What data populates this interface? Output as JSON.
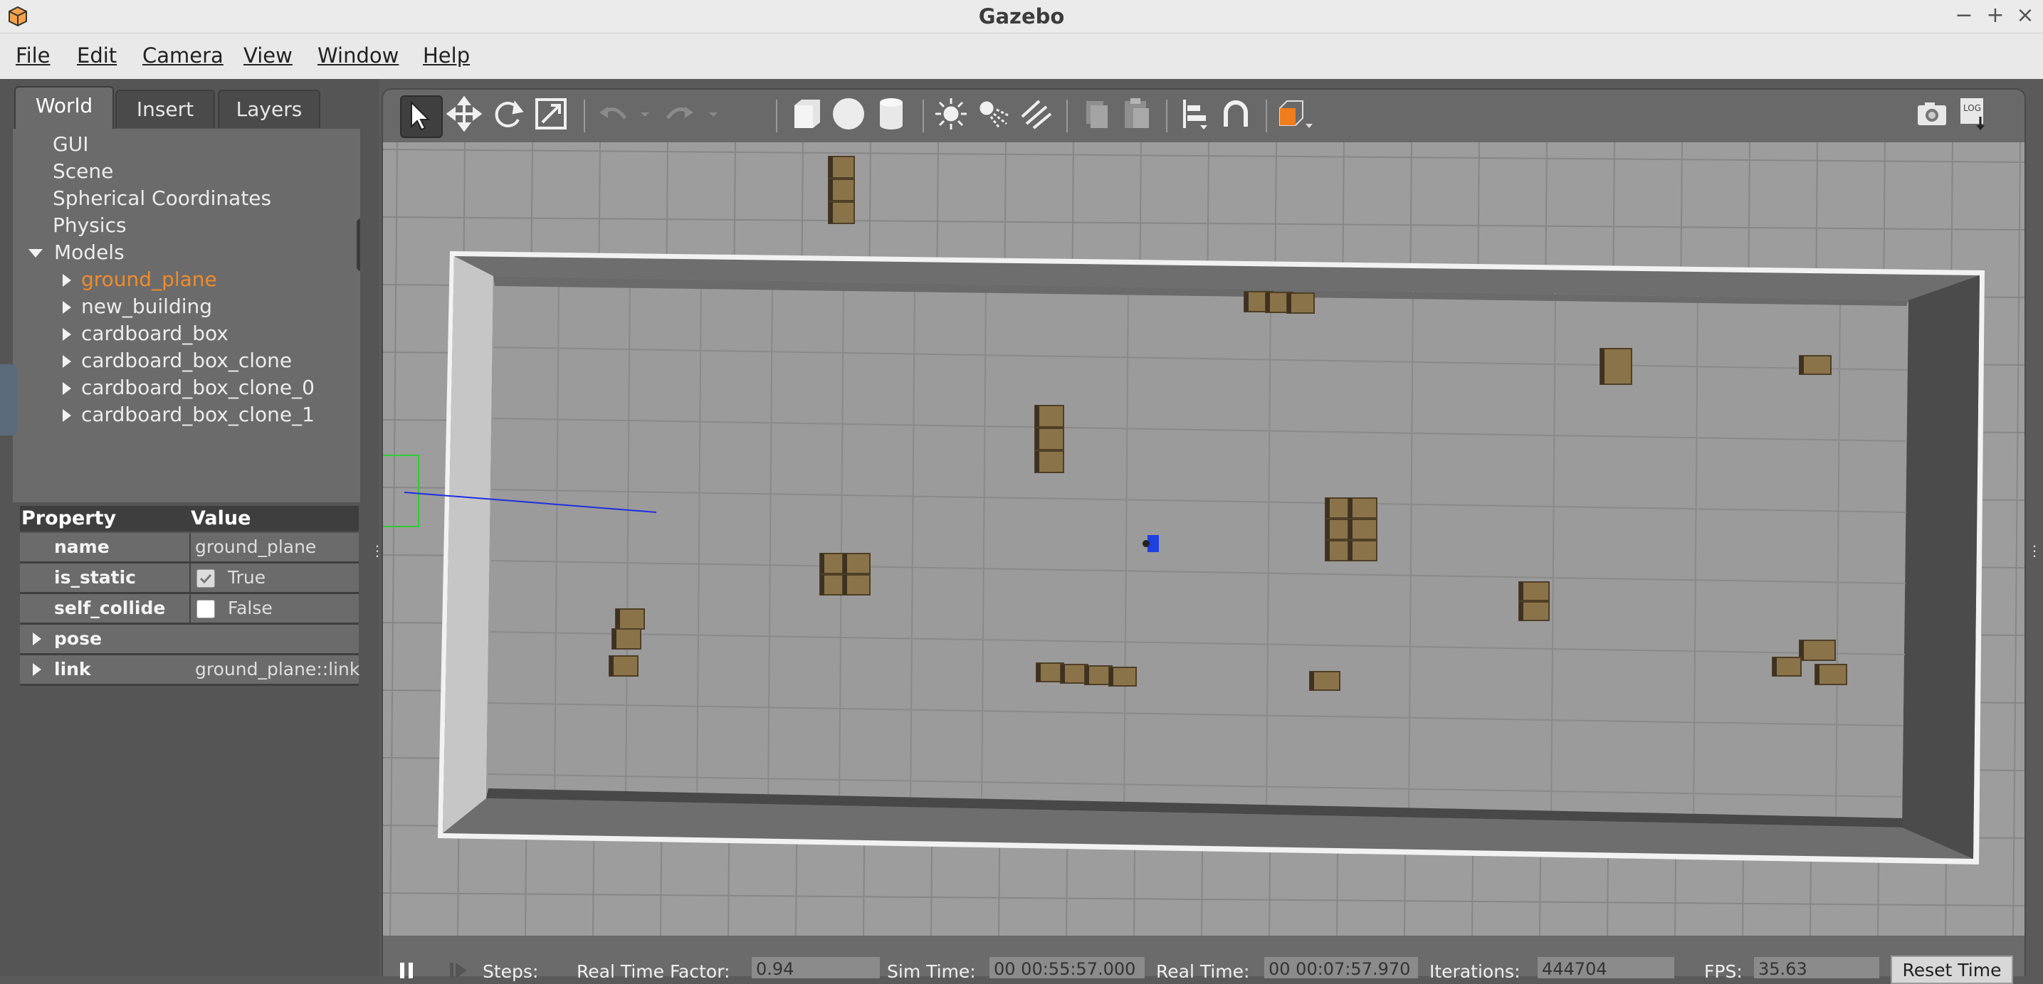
{
  "window": {
    "title": "Gazebo"
  },
  "menu": [
    "File",
    "Edit",
    "Camera",
    "View",
    "Window",
    "Help"
  ],
  "window_controls": {
    "minimize": "−",
    "maximize": "+",
    "close": "×"
  },
  "tabs": [
    "World",
    "Insert",
    "Layers"
  ],
  "tree": {
    "items": [
      "GUI",
      "Scene",
      "Spherical Coordinates",
      "Physics"
    ],
    "models_label": "Models",
    "models": [
      "ground_plane",
      "new_building",
      "cardboard_box",
      "cardboard_box_clone",
      "cardboard_box_clone_0",
      "cardboard_box_clone_1"
    ],
    "selected": "ground_plane"
  },
  "properties": {
    "header": {
      "property": "Property",
      "value": "Value"
    },
    "name": {
      "key": "name",
      "value": "ground_plane"
    },
    "is_static": {
      "key": "is_static",
      "value": "True",
      "checked": true
    },
    "self_collide": {
      "key": "self_collide",
      "value": "False",
      "checked": false
    },
    "pose": {
      "key": "pose"
    },
    "link": {
      "key": "link",
      "value": "ground_plane::link"
    }
  },
  "toolbar_icons": [
    "select-mode-icon",
    "translate-icon",
    "rotate-icon",
    "scale-icon",
    "undo-icon",
    "redo-icon",
    "box-icon",
    "sphere-icon",
    "cylinder-icon",
    "point-light-icon",
    "spot-light-icon",
    "directional-light-icon",
    "copy-icon",
    "paste-icon",
    "align-icon",
    "snap-icon",
    "view-angle-icon",
    "screenshot-icon",
    "log-icon"
  ],
  "colors": {
    "selected_item": "#f08b2a",
    "robot": "#1f3fe0",
    "box": "#8b7349"
  },
  "status": {
    "steps_label": "Steps:",
    "rtf_label": "Real Time Factor:",
    "rtf": "0.94",
    "sim_time_label": "Sim Time:",
    "sim_time": "00 00:55:57.000",
    "real_time_label": "Real Time:",
    "real_time": "00 00:07:57.970",
    "iterations_label": "Iterations:",
    "iterations": "444704",
    "fps_label": "FPS:",
    "fps": "35.63",
    "reset_label": "Reset Time"
  }
}
